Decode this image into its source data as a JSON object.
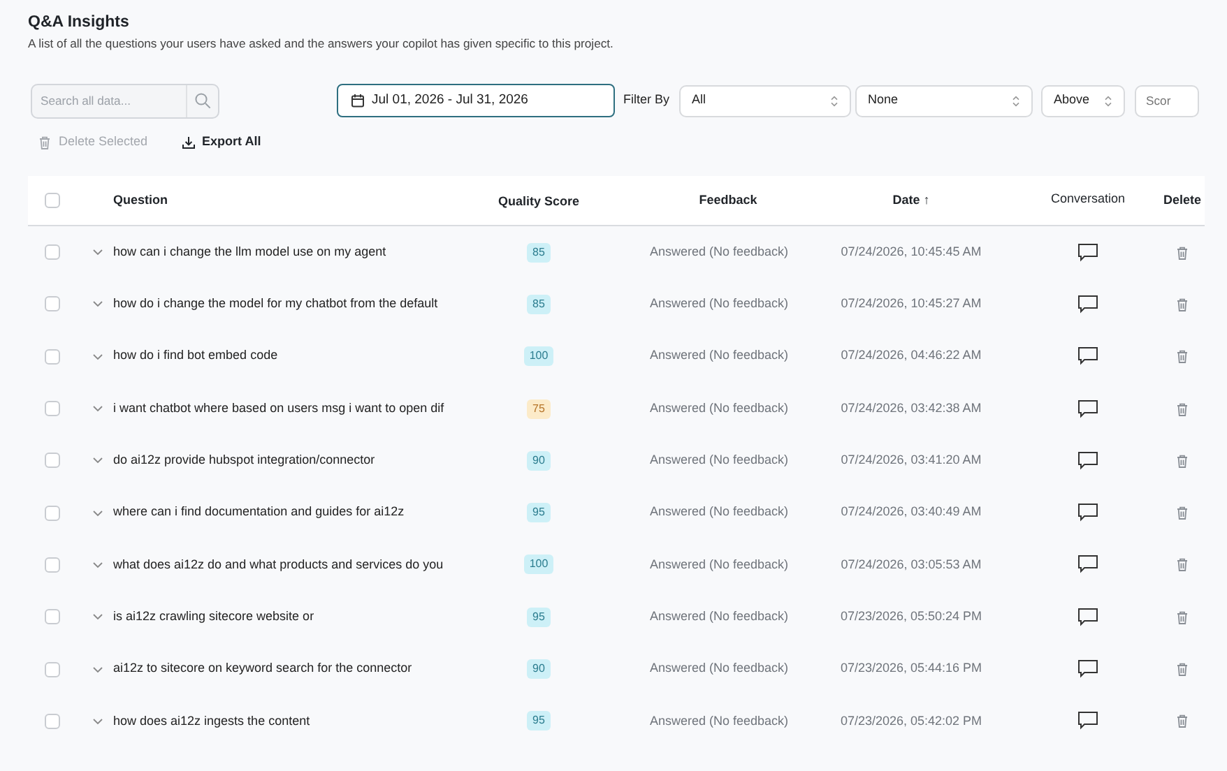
{
  "header": {
    "title": "Q&A Insights",
    "subtitle": "A list of all the questions your users have asked and the answers your copilot has given specific to this project."
  },
  "toolbar": {
    "search": {
      "placeholder": "Search all data..."
    },
    "date_range": "Jul 01, 2026 - Jul 31, 2026",
    "filter_label": "Filter By",
    "selects": [
      {
        "value": "All"
      },
      {
        "value": "None"
      },
      {
        "value": "Above"
      }
    ],
    "score_input": {
      "placeholder": "Scor"
    },
    "actions": [
      {
        "label": "Delete Selected",
        "disabled": true
      },
      {
        "label": "Export All",
        "disabled": false
      }
    ]
  },
  "table": {
    "select_all": {
      "checked": false
    },
    "columns": [
      {
        "label": "Question"
      },
      {
        "label": "Quality Score"
      },
      {
        "label": "Feedback"
      },
      {
        "label": "Date",
        "sort_arrow": "↑"
      },
      {
        "label": "Conversation"
      },
      {
        "label": "Delete"
      }
    ],
    "rows": [
      {
        "checked": false,
        "question": "how can i change the llm model use on my agent",
        "score": "85",
        "color": "#cdf0f7",
        "feedback": "Answered (No feedback)",
        "date": "07/24/2026, 10:45:45 AM"
      },
      {
        "checked": false,
        "question": "how do i change the model for my chatbot from the default",
        "score": "85",
        "color": "#cdf0f7",
        "feedback": "Answered (No feedback)",
        "date": "07/24/2026, 10:45:27 AM"
      },
      {
        "checked": false,
        "question": "how do i find bot embed code",
        "score": "100",
        "color": "#cdf0f7",
        "feedback": "Answered (No feedback)",
        "date": "07/24/2026, 04:46:22 AM"
      },
      {
        "checked": false,
        "question": "i want chatbot where based on users msg i want to open dif",
        "score": "75",
        "color": "#fcebc9",
        "feedback": "Answered (No feedback)",
        "date": "07/24/2026, 03:42:38 AM"
      },
      {
        "checked": false,
        "question": "do ai12z provide hubspot integration/connector",
        "score": "90",
        "color": "#cdf0f7",
        "feedback": "Answered (No feedback)",
        "date": "07/24/2026, 03:41:20 AM"
      },
      {
        "checked": false,
        "question": "where can i find documentation and guides for ai12z",
        "score": "95",
        "color": "#cdf0f7",
        "feedback": "Answered (No feedback)",
        "date": "07/24/2026, 03:40:49 AM"
      },
      {
        "checked": false,
        "question": "what does ai12z do and what products and services do you",
        "score": "100",
        "color": "#cdf0f7",
        "feedback": "Answered (No feedback)",
        "date": "07/24/2026, 03:05:53 AM"
      },
      {
        "checked": false,
        "question": "is ai12z crawling sitecore website or",
        "score": "95",
        "color": "#cdf0f7",
        "feedback": "Answered (No feedback)",
        "date": "07/23/2026, 05:50:24 PM"
      },
      {
        "checked": false,
        "question": "ai12z to sitecore on keyword search for the connector",
        "score": "90",
        "color": "#cdf0f7",
        "feedback": "Answered (No feedback)",
        "date": "07/23/2026, 05:44:16 PM"
      },
      {
        "checked": false,
        "question": "how does ai12z ingests the content",
        "score": "95",
        "color": "#cdf0f7",
        "feedback": "Answered (No feedback)",
        "date": "07/23/2026, 05:42:02 PM"
      }
    ]
  }
}
